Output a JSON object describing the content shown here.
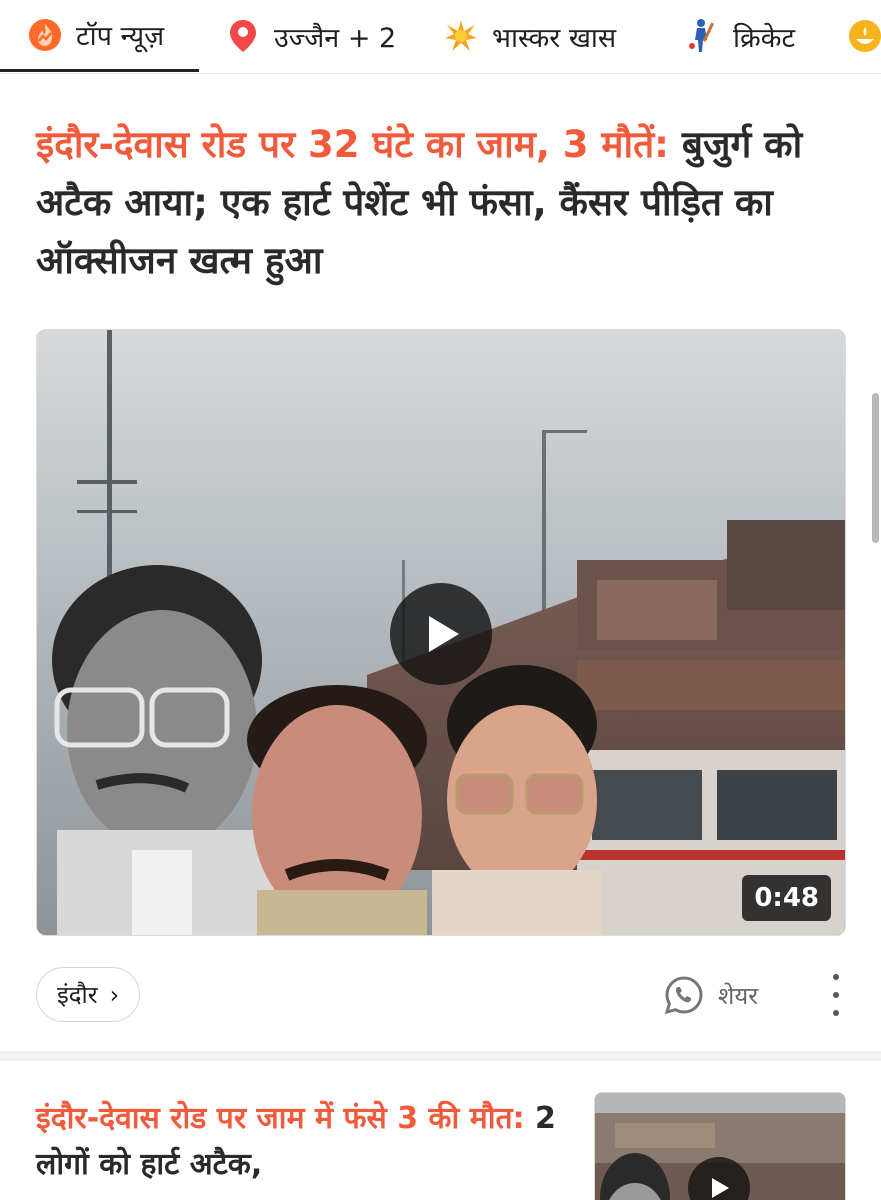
{
  "nav": {
    "tabs": [
      {
        "label": "टॉप न्यूज़",
        "icon": "trending-fire-icon",
        "active": true
      },
      {
        "label": "उज्जैन + 2",
        "icon": "location-pin-icon",
        "active": false
      },
      {
        "label": "भास्कर खास",
        "icon": "star-burst-icon",
        "active": false
      },
      {
        "label": "क्रिकेट",
        "icon": "cricket-player-icon",
        "active": false
      },
      {
        "label": "",
        "icon": "diya-icon",
        "active": false
      }
    ]
  },
  "story1": {
    "headline_highlight": "इंदौर-देवास रोड पर 32 घंटे का जाम, 3 मौतें:",
    "headline_rest": " बुजुर्ग को अटैक आया; एक हार्ट पेशेंट भी फंसा, कैंसर पीड़ित का ऑक्सीजन खत्म हुआ",
    "video_duration": "0:48",
    "location_chip": "इंदौर",
    "share_label": "शेयर"
  },
  "story2": {
    "headline_highlight": "इंदौर-देवास रोड पर जाम में फंसे 3 की मौत:",
    "headline_rest": " 2 लोगों को हार्ट अटैक,"
  },
  "colors": {
    "accent": "#f15a3b",
    "headline_text": "#2a2a2a",
    "nav_text": "#1f1f1f"
  }
}
